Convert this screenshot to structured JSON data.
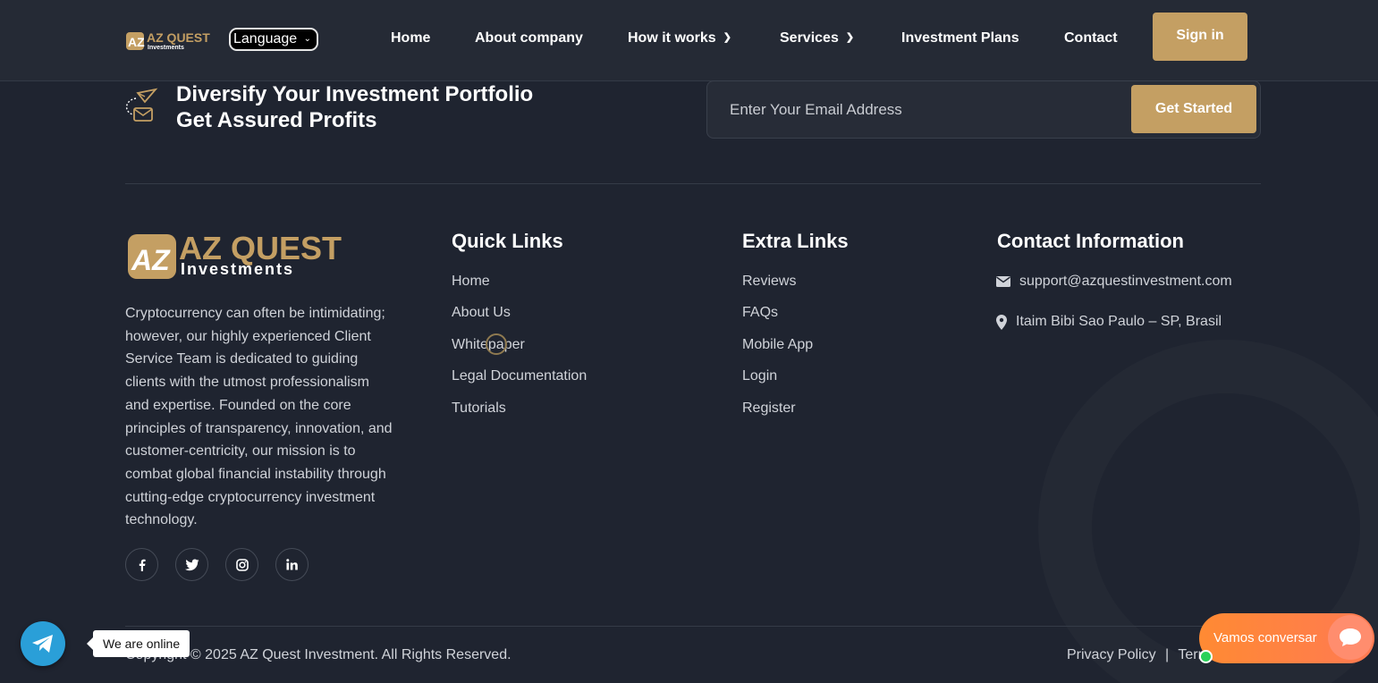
{
  "header": {
    "logo_text": "AZ QUEST",
    "logo_sub": "Investments",
    "language_label": "Language",
    "nav": [
      {
        "label": "Home"
      },
      {
        "label": "About company"
      },
      {
        "label": "How it works",
        "dropdown": true
      },
      {
        "label": "Services",
        "dropdown": true
      },
      {
        "label": "Investment Plans"
      },
      {
        "label": "Contact"
      }
    ],
    "signin_label": "Sign in"
  },
  "newsletter": {
    "title_line1": "Diversify Your Investment Portfolio",
    "title_line2": "Get Assured Profits",
    "email_placeholder": "Enter Your Email Address",
    "button_label": "Get Started",
    "icon": "paper-plane-mail-icon"
  },
  "footer": {
    "logo_text": "AZ QUEST",
    "logo_sub": "Investments",
    "about_text": "Cryptocurrency can often be intimidating; however, our highly experienced Client Service Team is dedicated to guiding clients with the utmost professionalism and expertise. Founded on the core principles of transparency, innovation, and customer-centricity, our mission is to combat global financial instability through cutting-edge cryptocurrency investment technology.",
    "quick_links": {
      "title": "Quick Links",
      "items": [
        "Home",
        "About Us",
        "Whitepaper",
        "Legal Documentation",
        "Tutorials"
      ]
    },
    "extra_links": {
      "title": "Extra Links",
      "items": [
        "Reviews",
        "FAQs",
        "Mobile App",
        "Login",
        "Register"
      ]
    },
    "contact": {
      "title": "Contact Information",
      "email": "support@azquestinvestment.com",
      "address": "Itaim Bibi Sao Paulo – SP, Brasil"
    },
    "social": [
      {
        "name": "facebook-icon",
        "glyph": "f"
      },
      {
        "name": "twitter-icon",
        "glyph": "t"
      },
      {
        "name": "instagram-icon",
        "glyph": "ig"
      },
      {
        "name": "linkedin-icon",
        "glyph": "in"
      }
    ],
    "copyright": "Copyright © 2025 AZ Quest Investment. All Rights Reserved.",
    "privacy": "Privacy Policy",
    "separator": "|",
    "terms": "Terms"
  },
  "widgets": {
    "online_text": "We are online",
    "chat_text": "Vamos conversar"
  },
  "colors": {
    "background": "#1f2430",
    "accent": "#c49f63",
    "telegram": "#2a9fd8",
    "chat_orange": "#ff8a33"
  }
}
